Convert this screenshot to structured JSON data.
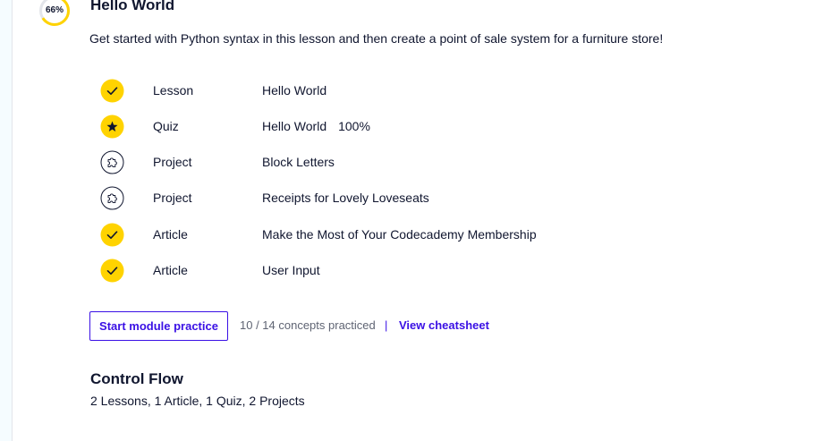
{
  "module": {
    "progress_label": "66%",
    "progress_value": 0.66,
    "title": "Hello World",
    "description": "Get started with Python syntax in this lesson and then create a point of sale system for a furniture store!"
  },
  "items": [
    {
      "status": "complete",
      "icon": "check-icon",
      "type": "Lesson",
      "title": "Hello World",
      "score": ""
    },
    {
      "status": "star",
      "icon": "star-icon",
      "type": "Quiz",
      "title": "Hello World",
      "score": "100%"
    },
    {
      "status": "incomplete",
      "icon": "puzzle-icon",
      "type": "Project",
      "title": "Block Letters",
      "score": ""
    },
    {
      "status": "incomplete",
      "icon": "puzzle-icon",
      "type": "Project",
      "title": "Receipts for Lovely Loveseats",
      "score": ""
    },
    {
      "status": "complete",
      "icon": "check-icon",
      "type": "Article",
      "title": "Make the Most of Your Codecademy Membership",
      "score": ""
    },
    {
      "status": "complete",
      "icon": "check-icon",
      "type": "Article",
      "title": "User Input",
      "score": ""
    }
  ],
  "actions": {
    "practice_button": "Start module practice",
    "concepts_text": "10 / 14 concepts practiced",
    "divider": "|",
    "cheatsheet_link": "View cheatsheet"
  },
  "next_module": {
    "title": "Control Flow",
    "summary": "2 Lessons, 1 Article, 1 Quiz, 2 Projects"
  },
  "colors": {
    "accent_yellow": "#ffd300",
    "brand_purple": "#3a10e5",
    "text_dark": "#10162f",
    "muted_text": "#5f6473",
    "ring_track": "#e3e5ea"
  }
}
